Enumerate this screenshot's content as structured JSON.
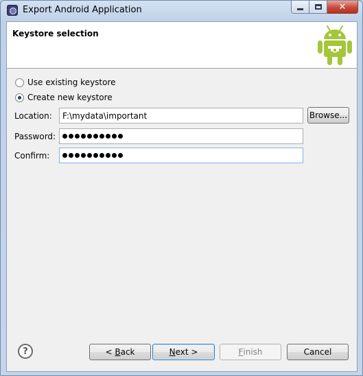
{
  "window": {
    "title": "Export Android Application"
  },
  "banner": {
    "title": "Keystore selection"
  },
  "options": {
    "use_existing": "Use existing keystore",
    "create_new": "Create new keystore"
  },
  "form": {
    "location_label": "Location:",
    "location_value": "F:\\mydata\\important",
    "password_label": "Password:",
    "confirm_label": "Confirm:",
    "browse_label": "Browse..."
  },
  "buttons": {
    "back_prefix": "< ",
    "back_mnemonic": "B",
    "back_rest": "ack",
    "next_mnemonic": "N",
    "next_rest": "ext >",
    "finish_mnemonic": "F",
    "finish_rest": "inish",
    "cancel": "Cancel",
    "help_glyph": "?"
  },
  "colors": {
    "android_green": "#a4c639",
    "close_red": "#c8493a"
  },
  "icons": [
    "app-icon",
    "android-logo-icon",
    "help-icon",
    "minimize-icon",
    "maximize-icon",
    "close-icon"
  ]
}
